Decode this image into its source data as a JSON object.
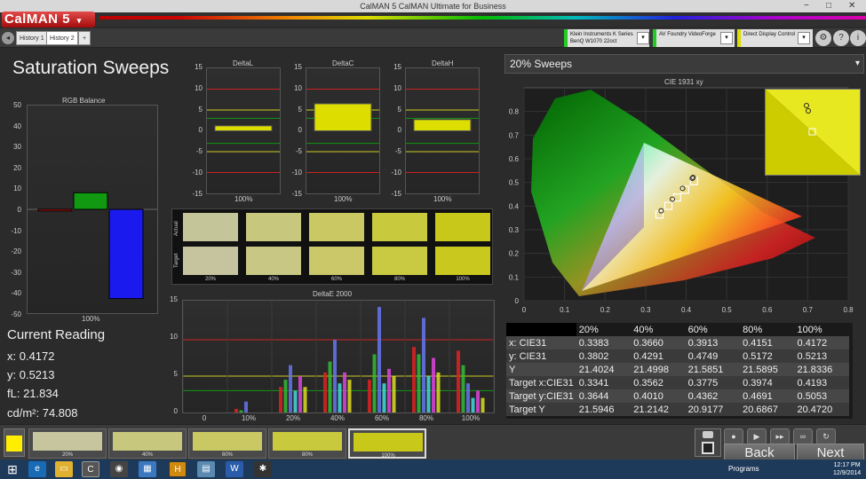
{
  "window": {
    "title": "CalMAN 5 CalMAN Ultimate for Business",
    "minimize": "−",
    "maximize": "□",
    "close": "✕"
  },
  "logo": {
    "text": "CalMAN 5",
    "arrow": "▾"
  },
  "tabs": {
    "back": "◂",
    "history1": "History 1",
    "history2": "History 2",
    "add": "+"
  },
  "devices": [
    {
      "line1": "Klein Instruments K Series",
      "line2": "BenQ W1070 22oct",
      "color": "#22cc22"
    },
    {
      "line1": "AV Foundry VideoForge",
      "line2": "",
      "color": "#22cc22"
    },
    {
      "line1": "Direct Display Control",
      "line2": "",
      "color": "#dddd00"
    }
  ],
  "topright": {
    "settings": "⚙",
    "help": "?",
    "info": "i"
  },
  "page_title": "Saturation Sweeps",
  "rgb_balance": {
    "title": "RGB Balance",
    "ticks": [
      "50",
      "40",
      "30",
      "20",
      "10",
      "0",
      "-10",
      "-20",
      "-30",
      "-40",
      "-50"
    ],
    "xlabel": "100%"
  },
  "delta_charts": [
    {
      "title": "DeltaL",
      "ticks": [
        "15",
        "10",
        "5",
        "0",
        "-5",
        "-10",
        "-15"
      ],
      "xlabel": "100%",
      "value": 1.2
    },
    {
      "title": "DeltaC",
      "ticks": [
        "15",
        "10",
        "5",
        "0",
        "-5",
        "-10",
        "-15"
      ],
      "xlabel": "100%",
      "value": 6.5
    },
    {
      "title": "DeltaH",
      "ticks": [
        "15",
        "10",
        "5",
        "0",
        "-5",
        "-10",
        "-15"
      ],
      "xlabel": "100%",
      "value": 2.7
    }
  ],
  "swatch_grid": {
    "row_labels": [
      "Actual",
      "Target"
    ],
    "columns": [
      "20%",
      "40%",
      "60%",
      "80%",
      "100%"
    ],
    "actual_colors": [
      "#c5c59a",
      "#c8c77e",
      "#c9c862",
      "#c9c93e",
      "#c8c81a"
    ],
    "target_colors": [
      "#c5c49f",
      "#c8c784",
      "#cac868",
      "#c9c942",
      "#c8c81e"
    ]
  },
  "current_reading": {
    "title": "Current Reading",
    "x": "x: 0.4172",
    "y": "y: 0.5213",
    "fL": "fL: 21.834",
    "cdm2": "cd/m²: 74.808"
  },
  "deltae_chart": {
    "title": "DeltaE 2000",
    "ticks": [
      "15",
      "10",
      "5",
      "0"
    ],
    "xticks": [
      "0",
      "10%",
      "20%",
      "40%",
      "60%",
      "80%",
      "100%"
    ]
  },
  "sweep_dropdown": {
    "selected": "20% Sweeps",
    "arrow": "▾"
  },
  "cie": {
    "title": "CIE 1931 xy",
    "xticks": [
      "0",
      "0.1",
      "0.2",
      "0.3",
      "0.4",
      "0.5",
      "0.6",
      "0.7",
      "0.8"
    ],
    "yticks": [
      "0.8",
      "0.7",
      "0.6",
      "0.5",
      "0.4",
      "0.3",
      "0.2",
      "0.1",
      "0"
    ]
  },
  "table": {
    "header": [
      "",
      "20%",
      "40%",
      "60%",
      "80%",
      "100%"
    ],
    "rows": [
      [
        "x: CIE31",
        "0.3383",
        "0.3660",
        "0.3913",
        "0.4151",
        "0.4172"
      ],
      [
        "y: CIE31",
        "0.3802",
        "0.4291",
        "0.4749",
        "0.5172",
        "0.5213"
      ],
      [
        "Y",
        "21.4024",
        "21.4998",
        "21.5851",
        "21.5895",
        "21.8336"
      ],
      [
        "Target x:CIE31",
        "0.3341",
        "0.3562",
        "0.3775",
        "0.3974",
        "0.4193"
      ],
      [
        "Target y:CIE31",
        "0.3644",
        "0.4010",
        "0.4362",
        "0.4691",
        "0.5053"
      ],
      [
        "Target Y",
        "21.5946",
        "21.2142",
        "20.9177",
        "20.6867",
        "20.4720"
      ]
    ]
  },
  "bottom": {
    "swatches": [
      {
        "label": "20%",
        "color": "#c6c59e"
      },
      {
        "label": "40%",
        "color": "#c8c77e"
      },
      {
        "label": "60%",
        "color": "#c9c862"
      },
      {
        "label": "80%",
        "color": "#c9c93e"
      },
      {
        "label": "100%",
        "color": "#c8c81a"
      }
    ],
    "current_color": "#ffee00",
    "back": "Back",
    "next": "Next"
  },
  "taskbar": {
    "programs": "Programs",
    "time": "12:17 PM",
    "date": "12/9/2014"
  },
  "chart_data": [
    {
      "type": "bar",
      "title": "RGB Balance",
      "categories": [
        "100%"
      ],
      "series": [
        {
          "name": "R",
          "values": [
            -0.8
          ]
        },
        {
          "name": "G",
          "values": [
            8
          ]
        },
        {
          "name": "B",
          "values": [
            -43
          ]
        }
      ],
      "ylim": [
        -50,
        50
      ]
    },
    {
      "type": "bar",
      "title": "DeltaL",
      "categories": [
        "100%"
      ],
      "values": [
        1.2
      ],
      "ylim": [
        -15,
        15
      ]
    },
    {
      "type": "bar",
      "title": "DeltaC",
      "categories": [
        "100%"
      ],
      "values": [
        6.5
      ],
      "ylim": [
        -15,
        15
      ]
    },
    {
      "type": "bar",
      "title": "DeltaH",
      "categories": [
        "100%"
      ],
      "values": [
        2.7
      ],
      "ylim": [
        -15,
        15
      ]
    },
    {
      "type": "bar",
      "title": "DeltaE 2000",
      "categories": [
        "0",
        "10%",
        "20%",
        "40%",
        "60%",
        "80%",
        "100%"
      ],
      "ylim": [
        0,
        15
      ],
      "series": [
        {
          "name": "R",
          "values": [
            0,
            0.5,
            3.5,
            5.5,
            4.5,
            9,
            8.5
          ]
        },
        {
          "name": "G",
          "values": [
            0,
            0.3,
            4.5,
            7,
            8,
            8,
            6.5
          ]
        },
        {
          "name": "B",
          "values": [
            0,
            1.5,
            6.5,
            10,
            14.5,
            13,
            4
          ]
        },
        {
          "name": "C",
          "values": [
            0,
            0,
            3,
            4,
            4,
            5,
            2
          ]
        },
        {
          "name": "M",
          "values": [
            0,
            0,
            5,
            5.5,
            6,
            7.5,
            3
          ]
        },
        {
          "name": "Y",
          "values": [
            0,
            0,
            3.5,
            4.5,
            5,
            5.5,
            2
          ]
        }
      ]
    },
    {
      "type": "scatter",
      "title": "CIE 1931 xy",
      "xlim": [
        0,
        0.8
      ],
      "ylim": [
        0,
        0.9
      ],
      "measured": [
        [
          0.3383,
          0.3802
        ],
        [
          0.366,
          0.4291
        ],
        [
          0.3913,
          0.4749
        ],
        [
          0.4151,
          0.5172
        ],
        [
          0.4172,
          0.5213
        ]
      ],
      "targets": [
        [
          0.3341,
          0.3644
        ],
        [
          0.3562,
          0.401
        ],
        [
          0.3775,
          0.4362
        ],
        [
          0.3974,
          0.4691
        ],
        [
          0.4193,
          0.5053
        ]
      ]
    }
  ]
}
